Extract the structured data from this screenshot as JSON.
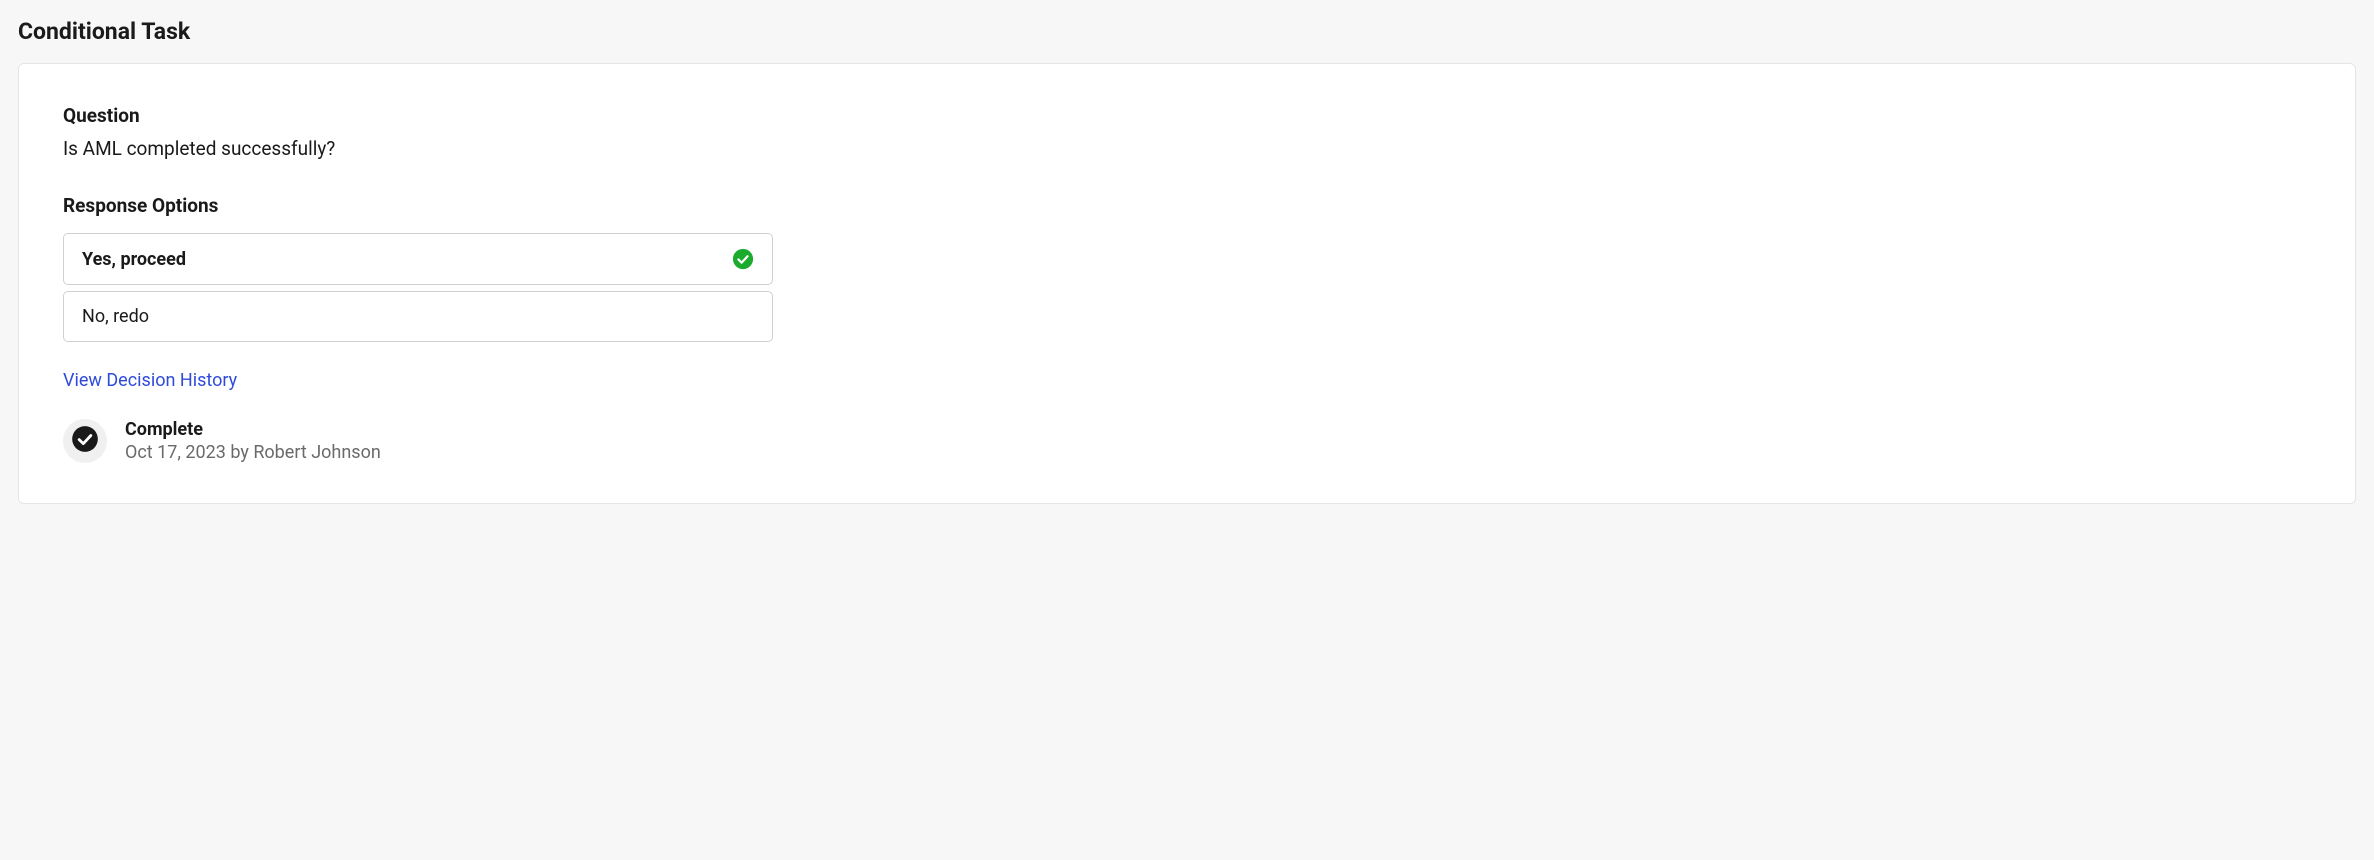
{
  "page": {
    "title": "Conditional Task"
  },
  "question": {
    "label": "Question",
    "text": "Is AML completed successfully?"
  },
  "responseOptions": {
    "label": "Response Options",
    "items": [
      {
        "label": "Yes, proceed",
        "selected": true
      },
      {
        "label": "No, redo",
        "selected": false
      }
    ]
  },
  "historyLink": {
    "label": "View Decision History"
  },
  "status": {
    "label": "Complete",
    "meta": "Oct 17, 2023 by Robert Johnson"
  }
}
